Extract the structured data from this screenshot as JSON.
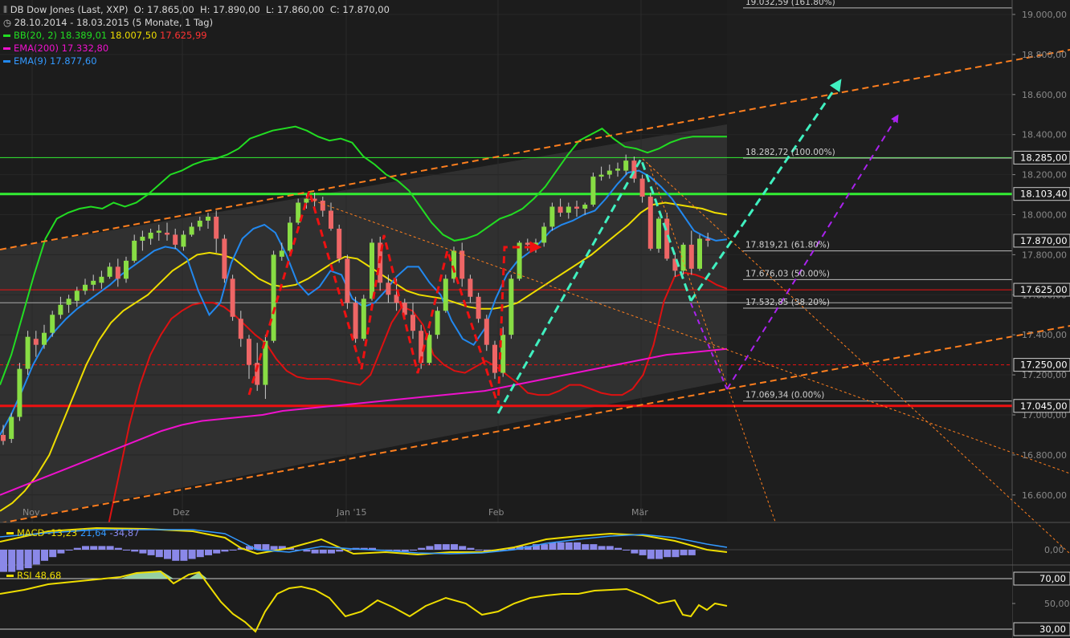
{
  "legend": {
    "title": "DB Dow Jones (Last, XXP)",
    "ohlc": {
      "o": "O: 17.865,00",
      "h": "H: 17.890,00",
      "l": "L: 17.860,00",
      "c": "C: 17.870,00"
    },
    "range": "28.10.2014 - 18.03.2015 (5 Monate, 1 Tag)",
    "bb": {
      "label": "BB(20, 2)",
      "upper": "18.389,01",
      "mid": "18.007,50",
      "lower": "17.625,99"
    },
    "ema200": {
      "label": "EMA(200)",
      "value": "17.332,80"
    },
    "ema9": {
      "label": "EMA(9)",
      "value": "17.877,60"
    }
  },
  "macd": {
    "label": "MACD",
    "v1": "-13,23",
    "v2": "21,64",
    "v3": "-34,87"
  },
  "rsi": {
    "label": "RSI",
    "value": "48,68"
  },
  "colors": {
    "background": "#1c1c1c",
    "channel_fill": "#333333",
    "bb_upper": "#22dd22",
    "bb_mid": "#eedd00",
    "bb_lower": "#dd1111",
    "ema200": "#ee11cc",
    "ema9": "#2288ee",
    "up_candle": "#88dd44",
    "down_candle": "#ee6666",
    "orange": "#ff7f1e",
    "cyan": "#40f0c0",
    "purple": "#aa22ee",
    "green_line": "#33ee33",
    "red_line": "#ee1111",
    "fib_line": "#bbbbbb"
  },
  "chart_data": {
    "type": "candlestick",
    "ylim": [
      16550,
      19050
    ],
    "y_ticks": [
      "19.000,00",
      "18.800,00",
      "18.600,00",
      "18.400,00",
      "18.200,00",
      "18.000,00",
      "17.800,00",
      "17.600,00",
      "17.400,00",
      "17.200,00",
      "17.000,00",
      "16.800,00",
      "16.600,00"
    ],
    "x_labels": [
      "Nov",
      "Dez",
      "Jan '15",
      "Feb",
      "Mär"
    ],
    "price_badges": [
      "18.285,00",
      "18.103,40",
      "17.870,00",
      "17.625,00",
      "17.250,00",
      "17.045,00"
    ],
    "fib_levels": [
      {
        "label": "19.032,59 (161.80%)",
        "value": 19032.59
      },
      {
        "label": "18.282,72 (100.00%)",
        "value": 18282.72
      },
      {
        "label": "17.819,21 (61.80%)",
        "value": 17819.21
      },
      {
        "label": "17.676,03 (50.00%)",
        "value": 17676.03
      },
      {
        "label": "17.532,85 (38.20%)",
        "value": 17532.85
      },
      {
        "label": "17.069,34 (0.00%)",
        "value": 17069.34
      }
    ],
    "candles": [
      [
        16900,
        16950,
        16850,
        16870
      ],
      [
        16880,
        17010,
        16860,
        16990
      ],
      [
        16990,
        17260,
        16970,
        17230
      ],
      [
        17230,
        17420,
        17200,
        17390
      ],
      [
        17380,
        17420,
        17290,
        17350
      ],
      [
        17350,
        17450,
        17330,
        17410
      ],
      [
        17410,
        17520,
        17390,
        17500
      ],
      [
        17500,
        17590,
        17480,
        17550
      ],
      [
        17550,
        17600,
        17510,
        17580
      ],
      [
        17570,
        17640,
        17540,
        17620
      ],
      [
        17620,
        17680,
        17600,
        17650
      ],
      [
        17650,
        17700,
        17620,
        17670
      ],
      [
        17660,
        17720,
        17630,
        17690
      ],
      [
        17690,
        17760,
        17680,
        17740
      ],
      [
        17740,
        17780,
        17640,
        17680
      ],
      [
        17680,
        17790,
        17660,
        17770
      ],
      [
        17770,
        17900,
        17760,
        17870
      ],
      [
        17870,
        17920,
        17820,
        17890
      ],
      [
        17880,
        17930,
        17850,
        17910
      ],
      [
        17910,
        17950,
        17870,
        17920
      ],
      [
        17910,
        17960,
        17870,
        17900
      ],
      [
        17900,
        17930,
        17830,
        17850
      ],
      [
        17840,
        17920,
        17820,
        17900
      ],
      [
        17900,
        17960,
        17890,
        17940
      ],
      [
        17940,
        17990,
        17920,
        17970
      ],
      [
        17970,
        18010,
        17930,
        17990
      ],
      [
        17990,
        18020,
        17810,
        17880
      ],
      [
        17880,
        17900,
        17660,
        17680
      ],
      [
        17680,
        17700,
        17470,
        17490
      ],
      [
        17480,
        17520,
        17340,
        17380
      ],
      [
        17380,
        17400,
        17180,
        17250
      ],
      [
        17260,
        17360,
        17120,
        17150
      ],
      [
        17150,
        17400,
        17080,
        17370
      ],
      [
        17370,
        17820,
        17360,
        17800
      ],
      [
        17790,
        17860,
        17770,
        17820
      ],
      [
        17820,
        17990,
        17800,
        17960
      ],
      [
        17960,
        18080,
        17950,
        18060
      ],
      [
        18060,
        18100,
        18030,
        18080
      ],
      [
        18080,
        18110,
        18040,
        18070
      ],
      [
        18070,
        18090,
        17990,
        18020
      ],
      [
        18020,
        18060,
        17920,
        17930
      ],
      [
        17930,
        17950,
        17760,
        17780
      ],
      [
        17780,
        17800,
        17530,
        17560
      ],
      [
        17560,
        17590,
        17360,
        17380
      ],
      [
        17380,
        17600,
        17370,
        17580
      ],
      [
        17580,
        17880,
        17570,
        17860
      ],
      [
        17860,
        17890,
        17620,
        17660
      ],
      [
        17660,
        17700,
        17560,
        17600
      ],
      [
        17600,
        17680,
        17520,
        17560
      ],
      [
        17560,
        17580,
        17480,
        17500
      ],
      [
        17500,
        17560,
        17380,
        17420
      ],
      [
        17420,
        17450,
        17230,
        17260
      ],
      [
        17260,
        17420,
        17250,
        17400
      ],
      [
        17400,
        17540,
        17380,
        17520
      ],
      [
        17520,
        17700,
        17510,
        17680
      ],
      [
        17680,
        17840,
        17660,
        17820
      ],
      [
        17820,
        17860,
        17640,
        17680
      ],
      [
        17680,
        17700,
        17560,
        17590
      ],
      [
        17590,
        17610,
        17460,
        17480
      ],
      [
        17480,
        17500,
        17320,
        17350
      ],
      [
        17350,
        17370,
        17180,
        17210
      ],
      [
        17210,
        17440,
        17190,
        17400
      ],
      [
        17400,
        17700,
        17380,
        17680
      ],
      [
        17680,
        17870,
        17670,
        17860
      ],
      [
        17860,
        17880,
        17820,
        17850
      ],
      [
        17850,
        17880,
        17810,
        17860
      ],
      [
        17860,
        17960,
        17840,
        17940
      ],
      [
        17940,
        18060,
        17920,
        18040
      ],
      [
        18040,
        18080,
        17990,
        18010
      ],
      [
        18010,
        18060,
        17980,
        18040
      ],
      [
        18040,
        18070,
        17990,
        18030
      ],
      [
        18030,
        18060,
        18000,
        18050
      ],
      [
        18050,
        18210,
        18040,
        18190
      ],
      [
        18190,
        18240,
        18170,
        18200
      ],
      [
        18200,
        18250,
        18180,
        18220
      ],
      [
        18220,
        18260,
        18190,
        18230
      ],
      [
        18220,
        18300,
        18200,
        18270
      ],
      [
        18270,
        18290,
        18160,
        18180
      ],
      [
        18180,
        18200,
        18060,
        18090
      ],
      [
        18090,
        18110,
        17820,
        17830
      ],
      [
        17830,
        17990,
        17810,
        17980
      ],
      [
        17980,
        18010,
        17770,
        17780
      ],
      [
        17780,
        17810,
        17690,
        17720
      ],
      [
        17720,
        17860,
        17700,
        17850
      ],
      [
        17850,
        17920,
        17700,
        17730
      ],
      [
        17730,
        17900,
        17720,
        17880
      ],
      [
        17880,
        17910,
        17840,
        17870
      ]
    ],
    "series": [
      {
        "name": "BB(20, 2)",
        "role": "upper",
        "values": [
          17150,
          17300,
          17500,
          17700,
          17880,
          17980,
          18010,
          18030,
          18040,
          18030,
          18060,
          18040,
          18060,
          18100,
          18150,
          18200,
          18220,
          18250,
          18270,
          18280,
          18300,
          18330,
          18380,
          18400,
          18420,
          18430,
          18440,
          18420,
          18390,
          18370,
          18380,
          18360,
          18290,
          18250,
          18200,
          18170,
          18120,
          18040,
          17960,
          17900,
          17870,
          17880,
          17900,
          17940,
          17980,
          18000,
          18030,
          18080,
          18140,
          18220,
          18300,
          18370,
          18400,
          18430,
          18380,
          18340,
          18330,
          18310,
          18330,
          18360,
          18380,
          18390,
          18390,
          18390,
          18390
        ]
      },
      {
        "name": "BB(20, 2)",
        "role": "mid",
        "values": [
          16520,
          16560,
          16620,
          16700,
          16800,
          16950,
          17100,
          17250,
          17370,
          17460,
          17520,
          17560,
          17600,
          17660,
          17720,
          17760,
          17800,
          17810,
          17800,
          17780,
          17730,
          17680,
          17650,
          17640,
          17650,
          17680,
          17720,
          17760,
          17790,
          17780,
          17740,
          17700,
          17660,
          17620,
          17600,
          17590,
          17580,
          17560,
          17540,
          17530,
          17530,
          17540,
          17560,
          17600,
          17640,
          17680,
          17720,
          17760,
          17800,
          17850,
          17900,
          17950,
          18010,
          18050,
          18060,
          18050,
          18040,
          18030,
          18010,
          18000
        ]
      },
      {
        "name": "BB(20, 2)",
        "role": "lower",
        "values": [
          16450,
          16700,
          16950,
          17150,
          17300,
          17400,
          17480,
          17520,
          17550,
          17560,
          17560,
          17540,
          17500,
          17450,
          17400,
          17360,
          17280,
          17220,
          17190,
          17180,
          17180,
          17180,
          17170,
          17160,
          17150,
          17200,
          17330,
          17460,
          17540,
          17520,
          17450,
          17300,
          17250,
          17220,
          17210,
          17240,
          17270,
          17240,
          17200,
          17160,
          17110,
          17100,
          17100,
          17120,
          17150,
          17150,
          17130,
          17110,
          17100,
          17100,
          17130,
          17200,
          17350,
          17570,
          17690,
          17710,
          17700,
          17680,
          17650,
          17630
        ]
      },
      {
        "name": "EMA(200)",
        "values": [
          16600,
          16640,
          16680,
          16720,
          16760,
          16800,
          16840,
          16880,
          16920,
          16950,
          16970,
          16980,
          16990,
          17000,
          17020,
          17030,
          17040,
          17050,
          17060,
          17070,
          17080,
          17090,
          17100,
          17110,
          17120,
          17140,
          17160,
          17180,
          17200,
          17220,
          17240,
          17260,
          17280,
          17300,
          17310,
          17320,
          17330
        ]
      },
      {
        "name": "EMA(9)",
        "values": [
          16900,
          17000,
          17120,
          17250,
          17350,
          17420,
          17480,
          17530,
          17570,
          17610,
          17650,
          17700,
          17740,
          17780,
          17820,
          17840,
          17830,
          17780,
          17620,
          17500,
          17560,
          17760,
          17880,
          17930,
          17950,
          17910,
          17800,
          17660,
          17600,
          17640,
          17720,
          17700,
          17580,
          17540,
          17560,
          17620,
          17690,
          17740,
          17740,
          17660,
          17600,
          17470,
          17380,
          17350,
          17430,
          17580,
          17700,
          17770,
          17810,
          17860,
          17920,
          17950,
          17970,
          18000,
          18020,
          18080,
          18150,
          18210,
          18220,
          18190,
          18140,
          18080,
          18000,
          17920,
          17890,
          17870,
          17877
        ]
      }
    ]
  }
}
